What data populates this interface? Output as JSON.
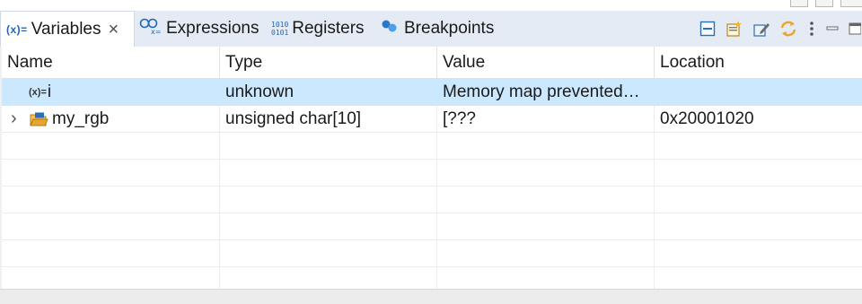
{
  "tabs": [
    {
      "label": "Variables",
      "icon": "variables-icon",
      "active": true,
      "closable": true
    },
    {
      "label": "Expressions",
      "icon": "expressions-icon",
      "active": false
    },
    {
      "label": "Registers",
      "icon": "registers-icon",
      "active": false
    },
    {
      "label": "Breakpoints",
      "icon": "breakpoints-icon",
      "active": false
    }
  ],
  "icons": {
    "variables_glyph": "(x)=",
    "registers_glyph_top": "1010",
    "registers_glyph_bottom": "0101",
    "close_glyph": "×",
    "expander_glyph": "›"
  },
  "toolbar": [
    "layout-icon",
    "new-folder-icon",
    "edit-icon",
    "sync-icon",
    "view-menu-icon",
    "minimize-icon",
    "maximize-icon"
  ],
  "table": {
    "columns": [
      "Name",
      "Type",
      "Value",
      "Location"
    ],
    "rows": [
      {
        "name": "i",
        "icon": "local-variable-icon",
        "type": "unknown",
        "value": "Memory map prevented…",
        "location": "",
        "selected": true,
        "expandable": false
      },
      {
        "name": "my_rgb",
        "icon": "array-variable-icon",
        "type": "unsigned char[10]",
        "value": "[???",
        "location": "0x20001020",
        "selected": false,
        "expandable": true
      }
    ],
    "empty_rows": 6
  },
  "colors": {
    "tabbar_bg": "#e4ebf5",
    "selected_row": "#cce8ff",
    "icon_blue": "#2266b2",
    "icon_orange": "#e8a530"
  }
}
